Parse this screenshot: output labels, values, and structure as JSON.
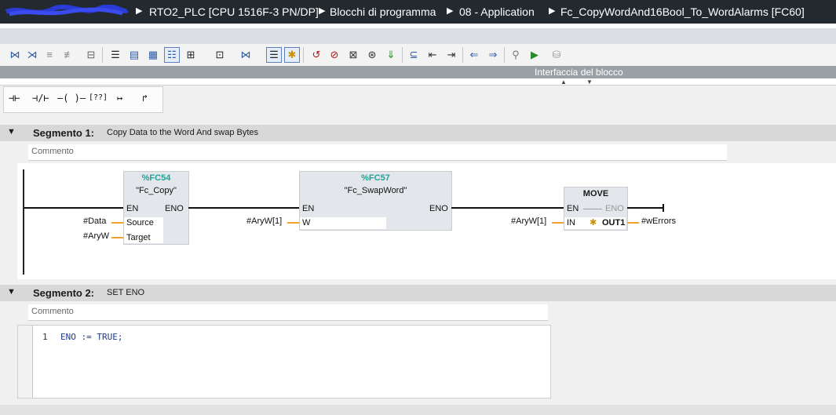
{
  "breadcrumb": {
    "items": [
      "RTO2_PLC [CPU 1516F-3 PN/DP]",
      "Blocchi di programma",
      "08 - Application",
      "Fc_CopyWordAnd16Bool_To_WordAlarms [FC60]"
    ]
  },
  "interface_bar": {
    "label": "Interfaccia del blocco"
  },
  "palette": {
    "items": [
      "⊣⊢",
      "⊣/⊢",
      "–( )–",
      "[??]",
      "↦",
      "↱"
    ]
  },
  "segments": [
    {
      "number": "Segmento 1:",
      "title": "Copy Data to the Word And swap Bytes",
      "comment": "Commento",
      "blocks": [
        {
          "number": "%FC54",
          "name": "\"Fc_Copy\"",
          "pins_in": [
            "EN",
            "Source",
            "Target"
          ],
          "pins_out": [
            "ENO"
          ],
          "operands_in": [
            "#Data",
            "#AryW"
          ]
        },
        {
          "number": "%FC57",
          "name": "\"Fc_SwapWord\"",
          "pins_in": [
            "EN",
            "W"
          ],
          "pins_out": [
            "ENO"
          ],
          "operands_in": [
            "#AryW[1]"
          ]
        },
        {
          "name": "MOVE",
          "pins_in": [
            "EN",
            "IN"
          ],
          "pins_out": [
            "ENO",
            "OUT1"
          ],
          "operands_in": [
            "#AryW[1]"
          ],
          "operands_out": [
            "#wErrors"
          ]
        }
      ]
    },
    {
      "number": "Segmento 2:",
      "title": "SET ENO",
      "comment": "Commento",
      "code": {
        "line_no": "1",
        "text": "ENO := TRUE;"
      }
    }
  ],
  "colors": {
    "accent": "#1ea39a",
    "operand_line": "#f0a030",
    "header_dark": "#222a30"
  }
}
